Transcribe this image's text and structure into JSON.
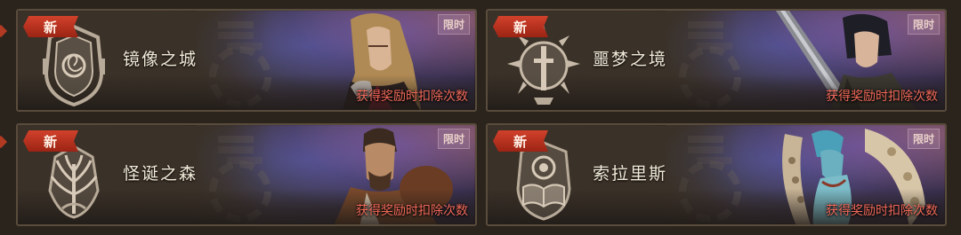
{
  "cards": [
    {
      "badge": "新",
      "title": "镜像之城",
      "tag": "限时",
      "note": "获得奖励时扣除次数",
      "emblem_icon": "mirror-spiral-emblem-icon",
      "character": "long-haired-man-portrait",
      "accent": "#d0a060"
    },
    {
      "badge": "新",
      "title": "噩梦之境",
      "tag": "限时",
      "note": "获得奖励时扣除次数",
      "emblem_icon": "sword-sunburst-emblem-icon",
      "character": "dark-swordsman-portrait",
      "accent": "#3a3a44"
    },
    {
      "badge": "新",
      "title": "怪诞之森",
      "tag": "限时",
      "note": "获得奖励时扣除次数",
      "emblem_icon": "tree-branches-emblem-icon",
      "character": "bearded-warrior-portrait",
      "accent": "#8a5a3a"
    },
    {
      "badge": "新",
      "title": "索拉里斯",
      "tag": "限时",
      "note": "获得奖励时扣除次数",
      "emblem_icon": "eye-book-emblem-icon",
      "character": "tentacle-creature-portrait",
      "accent": "#d8c6a8"
    }
  ],
  "colors": {
    "badge_red": "#c0331f",
    "note_red": "#f26a5a",
    "title_text": "#f1ead9",
    "frame": "#5a4c3c"
  }
}
